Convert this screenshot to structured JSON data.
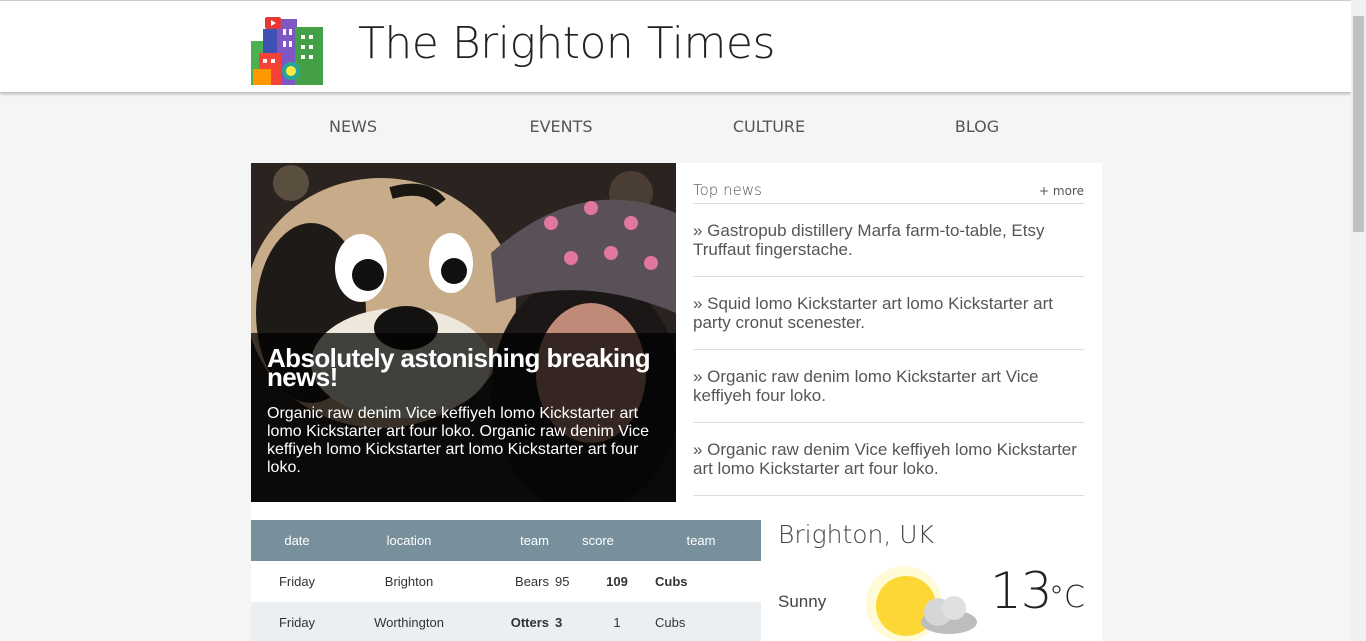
{
  "header": {
    "site_title": "The Brighton Times"
  },
  "nav": {
    "items": [
      "NEWS",
      "EVENTS",
      "CULTURE",
      "BLOG"
    ]
  },
  "hero": {
    "title": "Absolutely astonishing breaking news!",
    "text": "Organic raw denim Vice keffiyeh lomo Kickstarter art lomo Kickstarter art four loko. Organic raw denim Vice keffiyeh lomo Kickstarter art lomo Kickstarter art four loko."
  },
  "top_news": {
    "title": "Top news",
    "more_label": "+ more",
    "items": [
      "» Gastropub distillery Marfa farm-to-table, Etsy Truffaut fingerstache.",
      "» Squid lomo Kickstarter art lomo Kickstarter art party cronut scenester.",
      "» Organic raw denim lomo Kickstarter art Vice keffiyeh four loko.",
      "» Organic raw denim Vice keffiyeh lomo Kickstarter art lomo Kickstarter art four loko."
    ]
  },
  "scores_table": {
    "headers": [
      "date",
      "location",
      "team",
      "score",
      "team"
    ],
    "rows": [
      {
        "date": "Friday",
        "location": "Brighton",
        "team1": "Bears",
        "score1": "95",
        "score2": "109",
        "team2": "Cubs"
      },
      {
        "date": "Friday",
        "location": "Worthington",
        "team1": "Otters",
        "score1": "3",
        "score2": "1",
        "team2": "Cubs"
      }
    ]
  },
  "weather": {
    "city": "Brighton, UK",
    "condition": "Sunny",
    "temperature": "13",
    "unit": "°C",
    "icon": "sun-cloud-icon"
  },
  "colors": {
    "table_header": "#78909c",
    "table_alt_row": "#eceff1"
  }
}
